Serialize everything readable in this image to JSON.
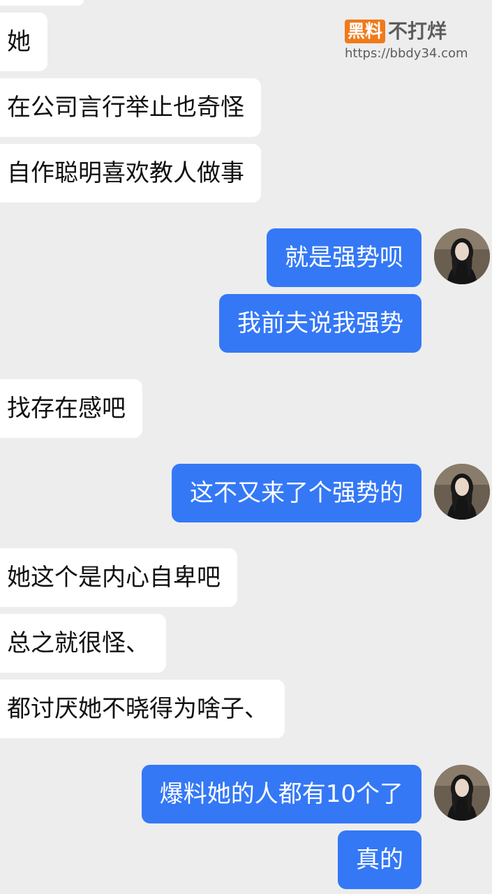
{
  "watermark": {
    "badge": "黑料",
    "name": "不打烊",
    "url": "https://bbdy34.com"
  },
  "messages": [
    {
      "side": "in",
      "text": "她"
    },
    {
      "side": "in",
      "text": "在公司言行举止也奇怪"
    },
    {
      "side": "in",
      "text": "自作聪明喜欢教人做事"
    },
    {
      "side": "out",
      "text": "就是强势呗"
    },
    {
      "side": "out",
      "text": "我前夫说我强势"
    },
    {
      "side": "in",
      "text": "找存在感吧"
    },
    {
      "side": "out",
      "text": "这不又来了个强势的"
    },
    {
      "side": "in",
      "text": "她这个是内心自卑吧"
    },
    {
      "side": "in",
      "text": "总之就很怪、"
    },
    {
      "side": "in",
      "text": "都讨厌她不晓得为啥子、"
    },
    {
      "side": "out",
      "text": "爆料她的人都有10个了"
    },
    {
      "side": "out",
      "text": "真的"
    }
  ],
  "colors": {
    "background": "#ededee",
    "incoming_bubble": "#ffffff",
    "outgoing_bubble": "#3478f6",
    "watermark_badge": "#f07a1a"
  },
  "icons": {
    "avatar": "user-avatar-photo"
  }
}
